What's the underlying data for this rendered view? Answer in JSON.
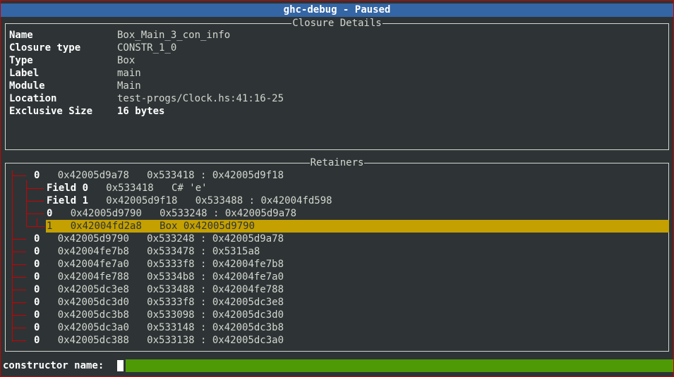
{
  "window": {
    "title": "ghc-debug - Paused"
  },
  "closure_details": {
    "panel_title": "Closure Details",
    "fields": [
      {
        "key": "Name",
        "value": "Box_Main_3_con_info"
      },
      {
        "key": "Closure type",
        "value": "CONSTR_1_0"
      },
      {
        "key": "Type",
        "value": "Box"
      },
      {
        "key": "Label",
        "value": "main"
      },
      {
        "key": "Module",
        "value": "Main"
      },
      {
        "key": "Location",
        "value": "test-progs/Clock.hs:41:16-25"
      },
      {
        "key": "Exclusive Size",
        "value": "16 bytes"
      }
    ]
  },
  "retainers": {
    "panel_title": "Retainers",
    "rows": [
      {
        "prefix": "0",
        "text": "   0x42005d9a78   0x533418 : 0x42005d9f18"
      },
      {
        "prefix": "Field 0",
        "text": "   0x533418   C# 'e'"
      },
      {
        "prefix": "Field 1",
        "text": "   0x42005d9f18   0x533488 : 0x42004fd598"
      },
      {
        "prefix": "0",
        "text": "   0x42005d9790   0x533248 : 0x42005d9a78"
      },
      {
        "prefix": "1",
        "text": "   0x42004fd2a8   Box 0x42005d9790"
      },
      {
        "prefix": "0",
        "text": "   0x42005d9790   0x533248 : 0x42005d9a78"
      },
      {
        "prefix": "0",
        "text": "   0x42004fe7b8   0x533478 : 0x5315a8"
      },
      {
        "prefix": "0",
        "text": "   0x42004fe7a0   0x5333f8 : 0x42004fe7b8"
      },
      {
        "prefix": "0",
        "text": "   0x42004fe788   0x5334b8 : 0x42004fe7a0"
      },
      {
        "prefix": "0",
        "text": "   0x42005dc3e8   0x533488 : 0x42004fe788"
      },
      {
        "prefix": "0",
        "text": "   0x42005dc3d0   0x5333f8 : 0x42005dc3e8"
      },
      {
        "prefix": "0",
        "text": "   0x42005dc3b8   0x533098 : 0x42005dc3d0"
      },
      {
        "prefix": "0",
        "text": "   0x42005dc3a0   0x533148 : 0x42005dc3b8"
      },
      {
        "prefix": "0",
        "text": "   0x42005dc388   0x533138 : 0x42005dc3a0"
      }
    ]
  },
  "command": {
    "label": "constructor name: ",
    "value": ""
  },
  "colors": {
    "background": "#2e3436",
    "title_bar": "#3465a4",
    "selection": "#c4a000",
    "tree_lines": "#cc0000",
    "input_bar": "#4e9a06"
  }
}
